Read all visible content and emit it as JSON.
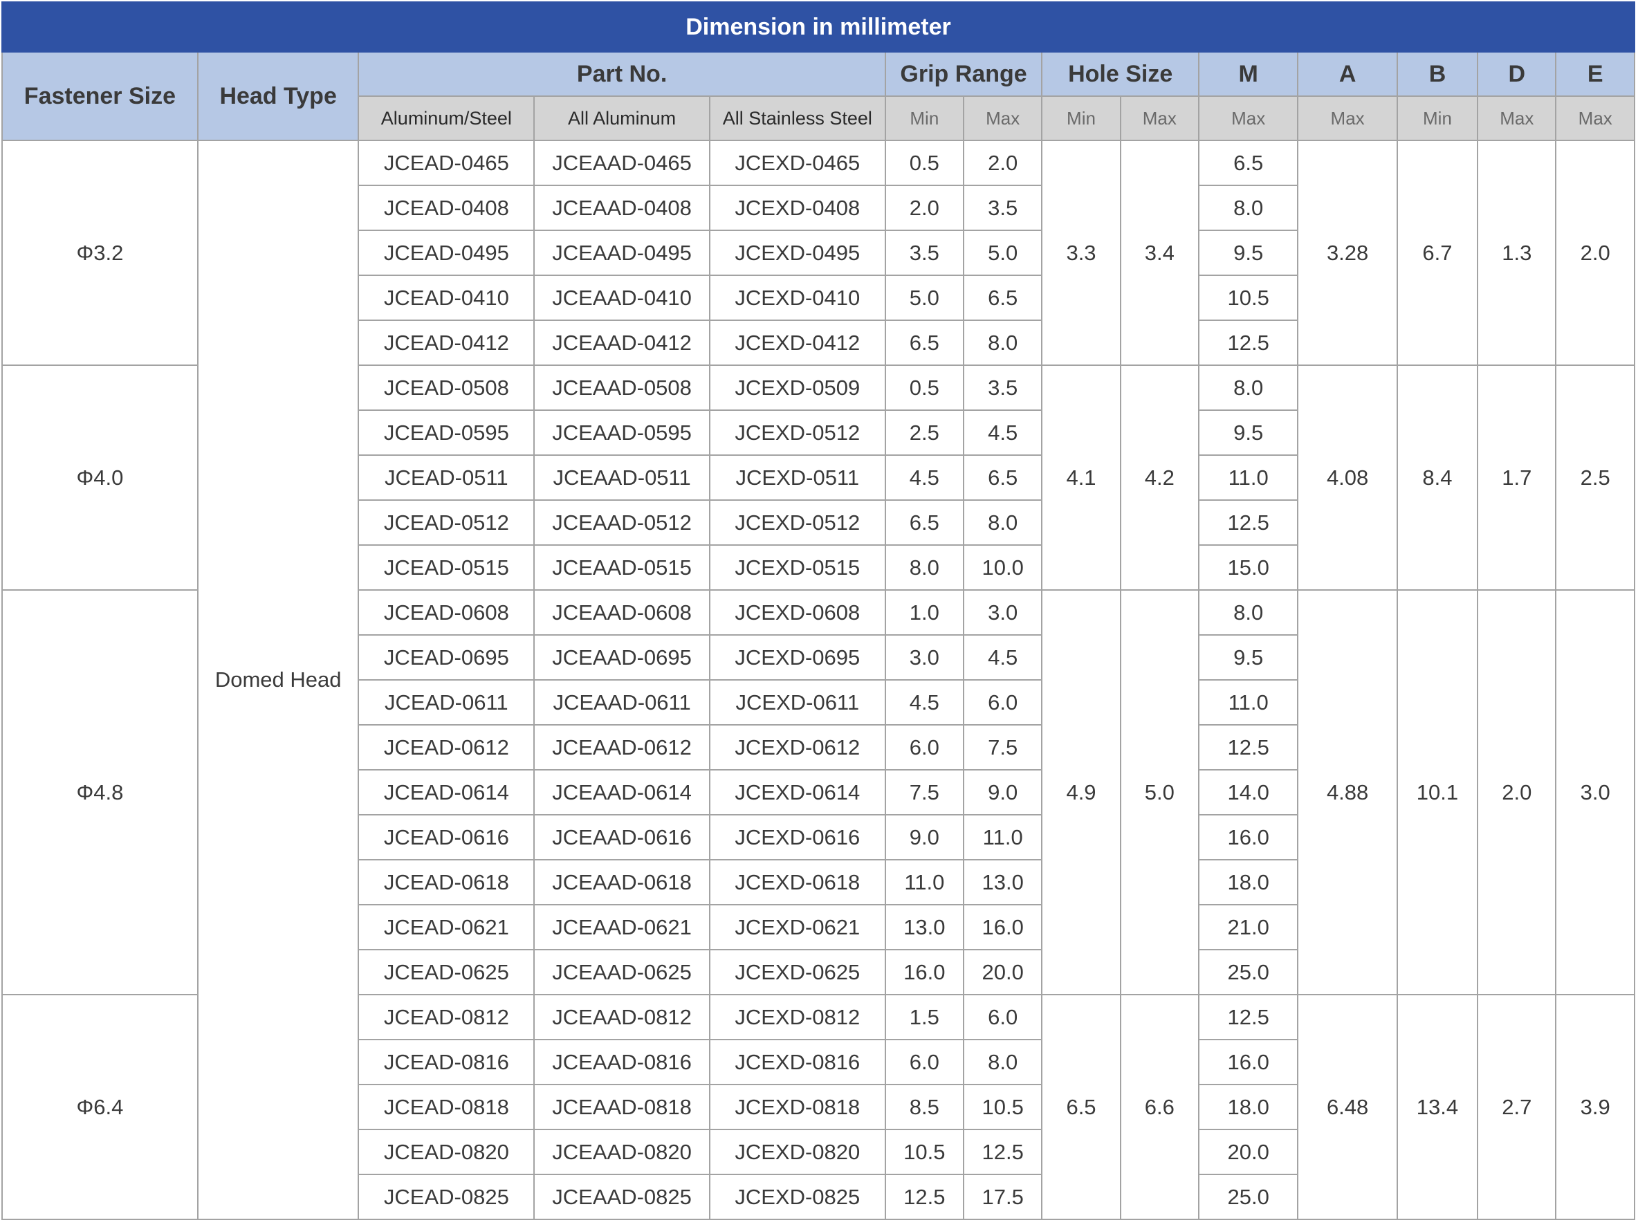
{
  "title": "Dimension in millimeter",
  "headers": {
    "fastener_size": "Fastener Size",
    "head_type": "Head Type",
    "part_no": "Part No.",
    "grip_range": "Grip Range",
    "hole_size": "Hole Size",
    "m": "M",
    "a": "A",
    "b": "B",
    "d": "D",
    "e": "E"
  },
  "subheaders": {
    "aluminum_steel": "Aluminum/Steel",
    "all_aluminum": "All Aluminum",
    "all_stainless": "All Stainless Steel",
    "grip_min": "Min",
    "grip_max": "Max",
    "hole_min": "Min",
    "hole_max": "Max",
    "m": "Max",
    "a": "Max",
    "b": "Min",
    "d": "Max",
    "e": "Max"
  },
  "head_type": "Domed Head",
  "colors": {
    "title_bg": "#2f52a4",
    "header_bg": "#b6c8e5",
    "subheader_bg": "#d4d4d4",
    "border": "#a3a3a3"
  },
  "groups": [
    {
      "size": "Φ3.2",
      "hole_min": "3.3",
      "hole_max": "3.4",
      "a": "3.28",
      "b": "6.7",
      "d": "1.3",
      "e": "2.0",
      "rows": [
        {
          "alu_steel": "JCEAD-0465",
          "all_alu": "JCEAAD-0465",
          "stainless": "JCEXD-0465",
          "grip_min": "0.5",
          "grip_max": "2.0",
          "m": "6.5"
        },
        {
          "alu_steel": "JCEAD-0408",
          "all_alu": "JCEAAD-0408",
          "stainless": "JCEXD-0408",
          "grip_min": "2.0",
          "grip_max": "3.5",
          "m": "8.0"
        },
        {
          "alu_steel": "JCEAD-0495",
          "all_alu": "JCEAAD-0495",
          "stainless": "JCEXD-0495",
          "grip_min": "3.5",
          "grip_max": "5.0",
          "m": "9.5"
        },
        {
          "alu_steel": "JCEAD-0410",
          "all_alu": "JCEAAD-0410",
          "stainless": "JCEXD-0410",
          "grip_min": "5.0",
          "grip_max": "6.5",
          "m": "10.5"
        },
        {
          "alu_steel": "JCEAD-0412",
          "all_alu": "JCEAAD-0412",
          "stainless": "JCEXD-0412",
          "grip_min": "6.5",
          "grip_max": "8.0",
          "m": "12.5"
        }
      ]
    },
    {
      "size": "Φ4.0",
      "hole_min": "4.1",
      "hole_max": "4.2",
      "a": "4.08",
      "b": "8.4",
      "d": "1.7",
      "e": "2.5",
      "rows": [
        {
          "alu_steel": "JCEAD-0508",
          "all_alu": "JCEAAD-0508",
          "stainless": "JCEXD-0509",
          "grip_min": "0.5",
          "grip_max": "3.5",
          "m": "8.0"
        },
        {
          "alu_steel": "JCEAD-0595",
          "all_alu": "JCEAAD-0595",
          "stainless": "JCEXD-0512",
          "grip_min": "2.5",
          "grip_max": "4.5",
          "m": "9.5"
        },
        {
          "alu_steel": "JCEAD-0511",
          "all_alu": "JCEAAD-0511",
          "stainless": "JCEXD-0511",
          "grip_min": "4.5",
          "grip_max": "6.5",
          "m": "11.0"
        },
        {
          "alu_steel": "JCEAD-0512",
          "all_alu": "JCEAAD-0512",
          "stainless": "JCEXD-0512",
          "grip_min": "6.5",
          "grip_max": "8.0",
          "m": "12.5"
        },
        {
          "alu_steel": "JCEAD-0515",
          "all_alu": "JCEAAD-0515",
          "stainless": "JCEXD-0515",
          "grip_min": "8.0",
          "grip_max": "10.0",
          "m": "15.0"
        }
      ]
    },
    {
      "size": "Φ4.8",
      "hole_min": "4.9",
      "hole_max": "5.0",
      "a": "4.88",
      "b": "10.1",
      "d": "2.0",
      "e": "3.0",
      "rows": [
        {
          "alu_steel": "JCEAD-0608",
          "all_alu": "JCEAAD-0608",
          "stainless": "JCEXD-0608",
          "grip_min": "1.0",
          "grip_max": "3.0",
          "m": "8.0"
        },
        {
          "alu_steel": "JCEAD-0695",
          "all_alu": "JCEAAD-0695",
          "stainless": "JCEXD-0695",
          "grip_min": "3.0",
          "grip_max": "4.5",
          "m": "9.5"
        },
        {
          "alu_steel": "JCEAD-0611",
          "all_alu": "JCEAAD-0611",
          "stainless": "JCEXD-0611",
          "grip_min": "4.5",
          "grip_max": "6.0",
          "m": "11.0"
        },
        {
          "alu_steel": "JCEAD-0612",
          "all_alu": "JCEAAD-0612",
          "stainless": "JCEXD-0612",
          "grip_min": "6.0",
          "grip_max": "7.5",
          "m": "12.5"
        },
        {
          "alu_steel": "JCEAD-0614",
          "all_alu": "JCEAAD-0614",
          "stainless": "JCEXD-0614",
          "grip_min": "7.5",
          "grip_max": "9.0",
          "m": "14.0"
        },
        {
          "alu_steel": "JCEAD-0616",
          "all_alu": "JCEAAD-0616",
          "stainless": "JCEXD-0616",
          "grip_min": "9.0",
          "grip_max": "11.0",
          "m": "16.0"
        },
        {
          "alu_steel": "JCEAD-0618",
          "all_alu": "JCEAAD-0618",
          "stainless": "JCEXD-0618",
          "grip_min": "11.0",
          "grip_max": "13.0",
          "m": "18.0"
        },
        {
          "alu_steel": "JCEAD-0621",
          "all_alu": "JCEAAD-0621",
          "stainless": "JCEXD-0621",
          "grip_min": "13.0",
          "grip_max": "16.0",
          "m": "21.0"
        },
        {
          "alu_steel": "JCEAD-0625",
          "all_alu": "JCEAAD-0625",
          "stainless": "JCEXD-0625",
          "grip_min": "16.0",
          "grip_max": "20.0",
          "m": "25.0"
        }
      ]
    },
    {
      "size": "Φ6.4",
      "hole_min": "6.5",
      "hole_max": "6.6",
      "a": "6.48",
      "b": "13.4",
      "d": "2.7",
      "e": "3.9",
      "rows": [
        {
          "alu_steel": "JCEAD-0812",
          "all_alu": "JCEAAD-0812",
          "stainless": "JCEXD-0812",
          "grip_min": "1.5",
          "grip_max": "6.0",
          "m": "12.5"
        },
        {
          "alu_steel": "JCEAD-0816",
          "all_alu": "JCEAAD-0816",
          "stainless": "JCEXD-0816",
          "grip_min": "6.0",
          "grip_max": "8.0",
          "m": "16.0"
        },
        {
          "alu_steel": "JCEAD-0818",
          "all_alu": "JCEAAD-0818",
          "stainless": "JCEXD-0818",
          "grip_min": "8.5",
          "grip_max": "10.5",
          "m": "18.0"
        },
        {
          "alu_steel": "JCEAD-0820",
          "all_alu": "JCEAAD-0820",
          "stainless": "JCEXD-0820",
          "grip_min": "10.5",
          "grip_max": "12.5",
          "m": "20.0"
        },
        {
          "alu_steel": "JCEAD-0825",
          "all_alu": "JCEAAD-0825",
          "stainless": "JCEXD-0825",
          "grip_min": "12.5",
          "grip_max": "17.5",
          "m": "25.0"
        }
      ]
    }
  ]
}
